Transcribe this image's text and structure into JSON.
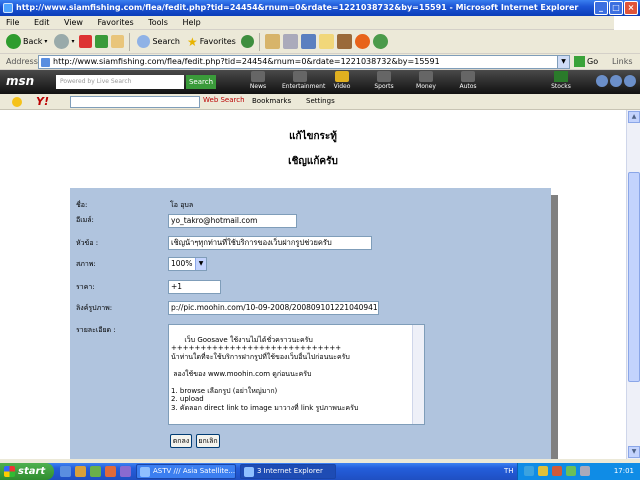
{
  "window": {
    "title": "http://www.siamfishing.com/flea/fedit.php?tid=24454&rnum=0&rdate=1221038732&by=15591 - Microsoft Internet Explorer"
  },
  "menu": [
    "File",
    "Edit",
    "View",
    "Favorites",
    "Tools",
    "Help"
  ],
  "toolbar": {
    "back": "Back",
    "search": "Search",
    "favorites": "Favorites"
  },
  "address": {
    "label": "Address",
    "url": "http://www.siamfishing.com/flea/fedit.php?tid=24454&rnum=0&rdate=1221038732&by=15591",
    "go": "Go",
    "links": "Links"
  },
  "msn": {
    "logo": "msn",
    "search_placeholder": "Powered by Live Search",
    "search_button": "Search",
    "items": [
      "News",
      "Entertainment",
      "Video",
      "Sports",
      "Money",
      "Autos"
    ],
    "stocks": "Stocks"
  },
  "yahoo": {
    "logo": "Y!",
    "web_search": "Web Search",
    "bookmarks": "Bookmarks",
    "settings": "Settings"
  },
  "page": {
    "heading1": "แก้ไขกระทู้",
    "heading2": "เชิญแก้ครับ",
    "form": {
      "name_label": "ชื่อ:",
      "name_value": "โอ อุบล",
      "email_label": "อีเมล์:",
      "email_value": "yo_takro@hotmail.com",
      "subject_label": "หัวข้อ :",
      "subject_value": "เชิญน้าๆทุกท่านที่ใช้บริการของเว็บฝากรูปช่วยครับ",
      "condition_label": "สภาพ:",
      "condition_value": "100%",
      "price_label": "ราคา:",
      "price_value": "+1",
      "image_link_label": "ลิงค์รูปภาพ:",
      "image_link_value": "p://pic.moohin.com/10-09-2008/200809101221040941.jpg",
      "detail_label": "รายละเอียด :",
      "detail_value": "เว็บ Goosave ใช้งานไม่ได้ชั่วคราวนะครับ\n+++++++++++++++++++++++++++++\nน้าท่านใดที่จะใช้บริการฝากรูปที่ใช้ของเว็บอื่นไปก่อนนะครับ\n\n ลองใช้ของ www.moohin.com ดูก่อนนะครับ\n\n1. browse เลือกรูป (อย่าใหญ่มาก)\n2. upload\n3. คัดลอก direct link to image มาวางที่ link รูปภาพนะครับ",
      "submit": "ตกลง",
      "cancel": "ยกเลิก"
    }
  },
  "taskbar": {
    "start": "start",
    "tasks": [
      "ASTV /// Asia Satellite...",
      "3 Internet Explorer"
    ],
    "lang": "TH",
    "clock": "17:01"
  }
}
